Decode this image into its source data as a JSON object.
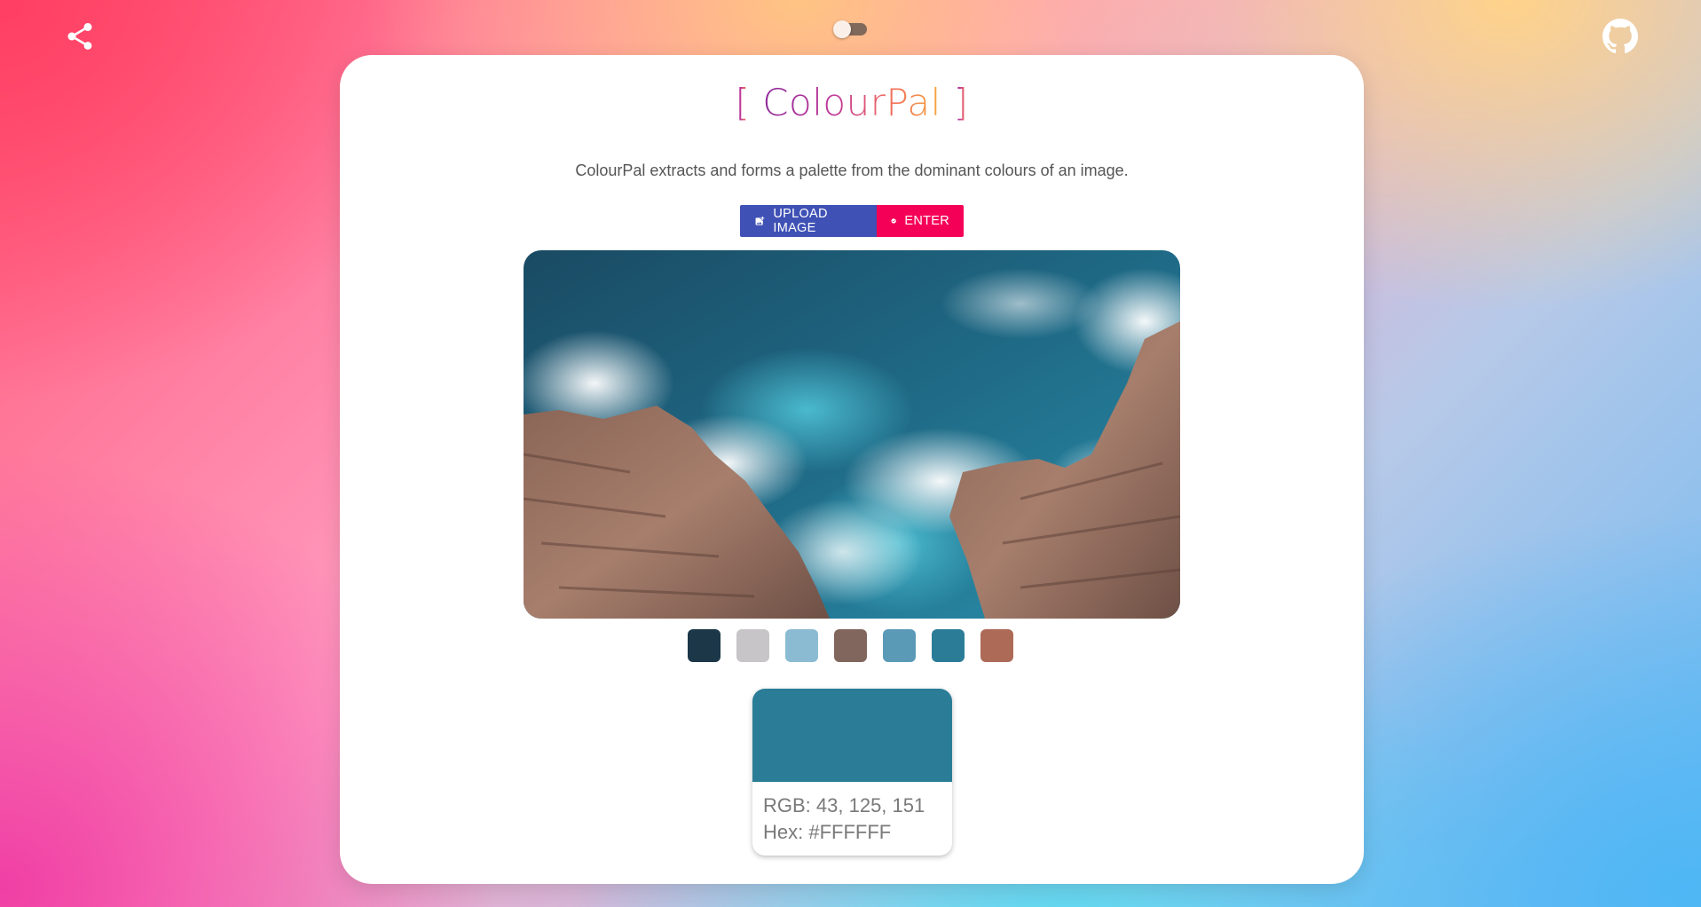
{
  "app": {
    "title_open": "[",
    "title_name": "ColourPal",
    "title_close": "]",
    "description": "ColourPal extracts and forms a palette from the dominant colours of an image."
  },
  "top_bar": {
    "share_icon": "share-icon",
    "github_icon": "github-icon",
    "theme_toggle": {
      "on": false
    }
  },
  "actions": {
    "upload_label": "UPLOAD IMAGE",
    "upload_icon": "add-photo-icon",
    "enter_label": "ENTER",
    "enter_icon": "check-circle-icon",
    "upload_color": "#3f51b5",
    "enter_color": "#f50057"
  },
  "palette": [
    {
      "color": "#1b3748"
    },
    {
      "color": "#c7c5c7"
    },
    {
      "color": "#8bbbd3"
    },
    {
      "color": "#81665d"
    },
    {
      "color": "#5a9ab7"
    },
    {
      "color": "#2b7d97"
    },
    {
      "color": "#ad6a56"
    }
  ],
  "selected": {
    "color": "#2b7d97",
    "rgb_text": "RGB: 43, 125, 151",
    "hex_text": "Hex: #FFFFFF"
  }
}
